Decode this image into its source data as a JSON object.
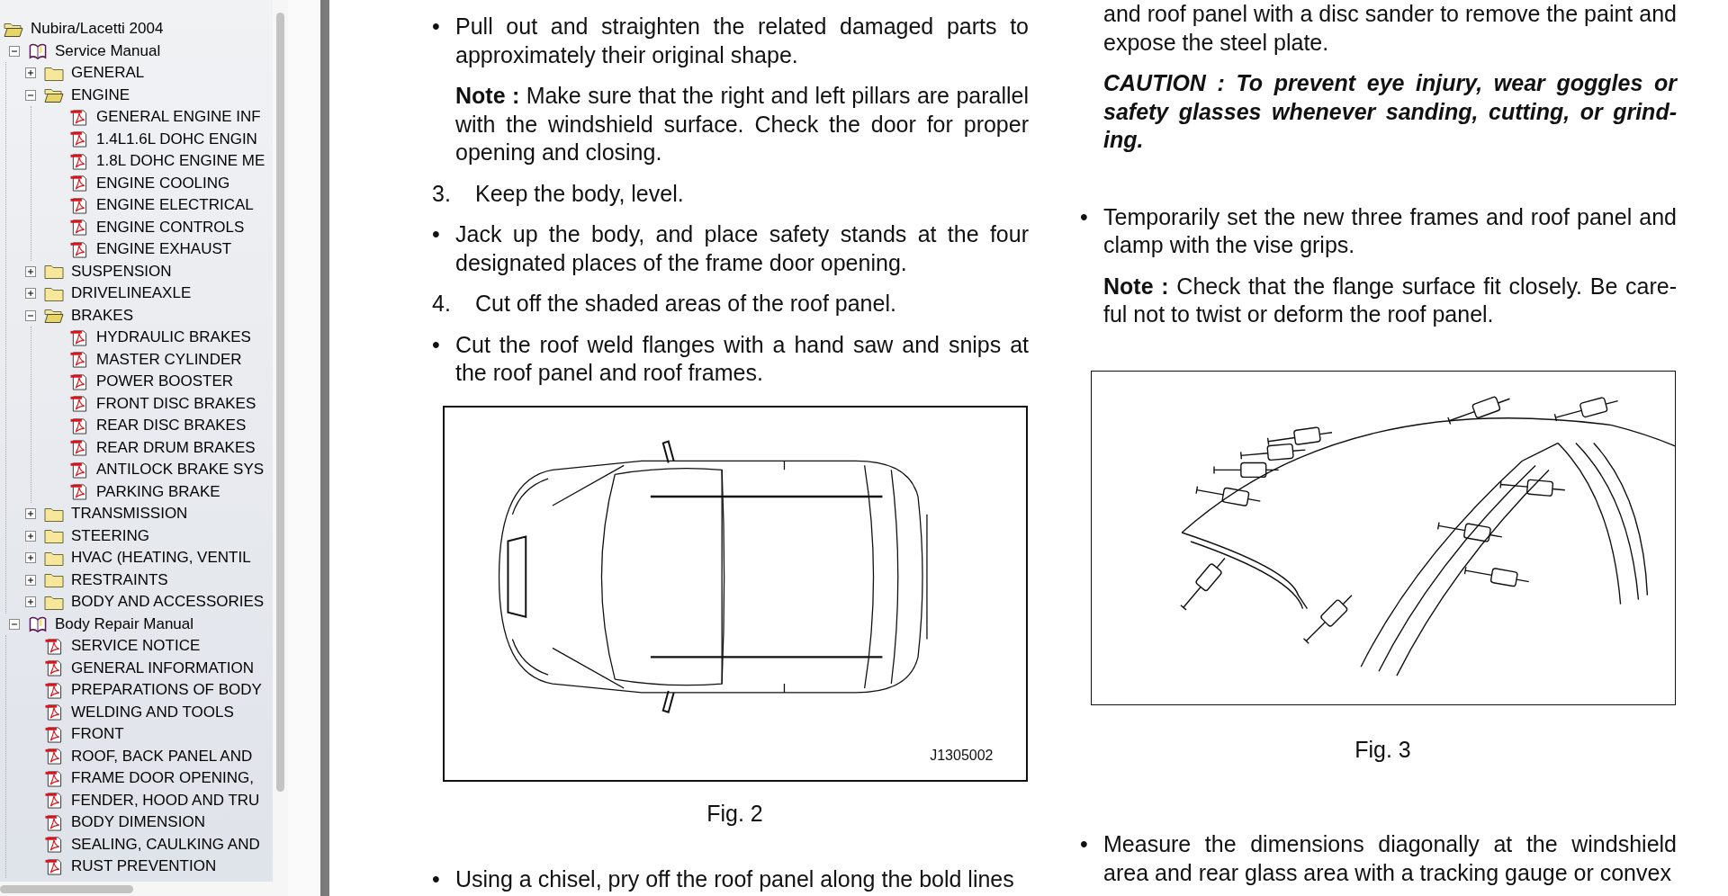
{
  "sidebar": {
    "root": "Nubira/Lacetti 2004",
    "tree": [
      {
        "label": "Service Manual",
        "kind": "book",
        "expanded": true,
        "children": [
          {
            "label": "GENERAL",
            "kind": "folder",
            "expanded": false
          },
          {
            "label": "ENGINE",
            "kind": "folder",
            "expanded": true,
            "children": [
              {
                "label": "GENERAL ENGINE INF",
                "kind": "pdf"
              },
              {
                "label": "1.4L1.6L DOHC ENGIN",
                "kind": "pdf"
              },
              {
                "label": "1.8L DOHC ENGINE ME",
                "kind": "pdf"
              },
              {
                "label": "ENGINE COOLING",
                "kind": "pdf"
              },
              {
                "label": "ENGINE ELECTRICAL",
                "kind": "pdf"
              },
              {
                "label": "ENGINE CONTROLS",
                "kind": "pdf"
              },
              {
                "label": "ENGINE EXHAUST",
                "kind": "pdf"
              }
            ]
          },
          {
            "label": "SUSPENSION",
            "kind": "folder",
            "expanded": false
          },
          {
            "label": "DRIVELINEAXLE",
            "kind": "folder",
            "expanded": false
          },
          {
            "label": "BRAKES",
            "kind": "folder",
            "expanded": true,
            "children": [
              {
                "label": "HYDRAULIC BRAKES",
                "kind": "pdf"
              },
              {
                "label": "MASTER CYLINDER",
                "kind": "pdf"
              },
              {
                "label": "POWER BOOSTER",
                "kind": "pdf"
              },
              {
                "label": "FRONT DISC BRAKES",
                "kind": "pdf"
              },
              {
                "label": "REAR DISC BRAKES",
                "kind": "pdf"
              },
              {
                "label": "REAR DRUM BRAKES",
                "kind": "pdf"
              },
              {
                "label": "ANTILOCK BRAKE SYS",
                "kind": "pdf"
              },
              {
                "label": "PARKING BRAKE",
                "kind": "pdf"
              }
            ]
          },
          {
            "label": "TRANSMISSION",
            "kind": "folder",
            "expanded": false
          },
          {
            "label": "STEERING",
            "kind": "folder",
            "expanded": false
          },
          {
            "label": "HVAC (HEATING, VENTIL",
            "kind": "folder",
            "expanded": false
          },
          {
            "label": "RESTRAINTS",
            "kind": "folder",
            "expanded": false
          },
          {
            "label": "BODY AND ACCESSORIES",
            "kind": "folder",
            "expanded": false
          }
        ]
      },
      {
        "label": "Body Repair Manual",
        "kind": "book",
        "expanded": true,
        "children": [
          {
            "label": "SERVICE NOTICE",
            "kind": "pdf"
          },
          {
            "label": "GENERAL INFORMATION",
            "kind": "pdf"
          },
          {
            "label": "PREPARATIONS OF BODY",
            "kind": "pdf"
          },
          {
            "label": "WELDING AND TOOLS",
            "kind": "pdf"
          },
          {
            "label": "FRONT",
            "kind": "pdf"
          },
          {
            "label": "ROOF, BACK PANEL AND",
            "kind": "pdf"
          },
          {
            "label": "FRAME DOOR OPENING,",
            "kind": "pdf"
          },
          {
            "label": "FENDER, HOOD AND TRU",
            "kind": "pdf"
          },
          {
            "label": "BODY DIMENSION",
            "kind": "pdf"
          },
          {
            "label": "SEALING, CAULKING AND",
            "kind": "pdf"
          },
          {
            "label": "RUST PREVENTION",
            "kind": "pdf"
          }
        ]
      }
    ]
  },
  "document": {
    "columns": [
      {
        "blocks": [
          {
            "kind": "bullet",
            "marker": "•",
            "text": "Pull out and straighten the related damaged parts to approximately their original shape."
          },
          {
            "kind": "note",
            "text": "**Note :** Make sure that the right and left pillars are parallel with the windshield surface. Check the door for proper opening and closing."
          },
          {
            "kind": "step",
            "number": "3.",
            "text": "Keep the body, level."
          },
          {
            "kind": "bullet",
            "marker": "•",
            "text": "Jack up the body, and place safety stands at the four designated places of the frame door opening."
          },
          {
            "kind": "step",
            "number": "4.",
            "text": "Cut off the shaded areas of the roof panel."
          },
          {
            "kind": "bullet",
            "marker": "•",
            "text": "Cut the roof weld flanges with a hand saw and snips at the roof panel and roof frames."
          },
          {
            "kind": "figure",
            "code": "J1305002",
            "caption": "Fig. 2"
          },
          {
            "kind": "bullet",
            "marker": "•",
            "text": "Using a chisel, pry off the roof panel along the bold lines"
          }
        ]
      },
      {
        "blocks": [
          {
            "kind": "plain",
            "text": "and roof panel with a disc sander to remove the paint and expose the steel plate."
          },
          {
            "kind": "caution",
            "text": "CAUTION : To prevent eye injury, wear goggles or safety glasses whenever sanding, cutting, or grind-ing."
          },
          {
            "kind": "bullet",
            "marker": "•",
            "text": "Temporarily set the new three frames and roof panel and clamp with the vise grips."
          },
          {
            "kind": "note",
            "text": "**Note :** Check that the flange surface fit closely. Be care-ful not to twist or deform the roof panel."
          },
          {
            "kind": "figure",
            "caption": "Fig. 3"
          },
          {
            "kind": "bullet",
            "marker": "•",
            "text": "Measure the dimensions diagonally at the windshield area and rear glass area with a tracking gauge or convex"
          }
        ]
      }
    ]
  }
}
